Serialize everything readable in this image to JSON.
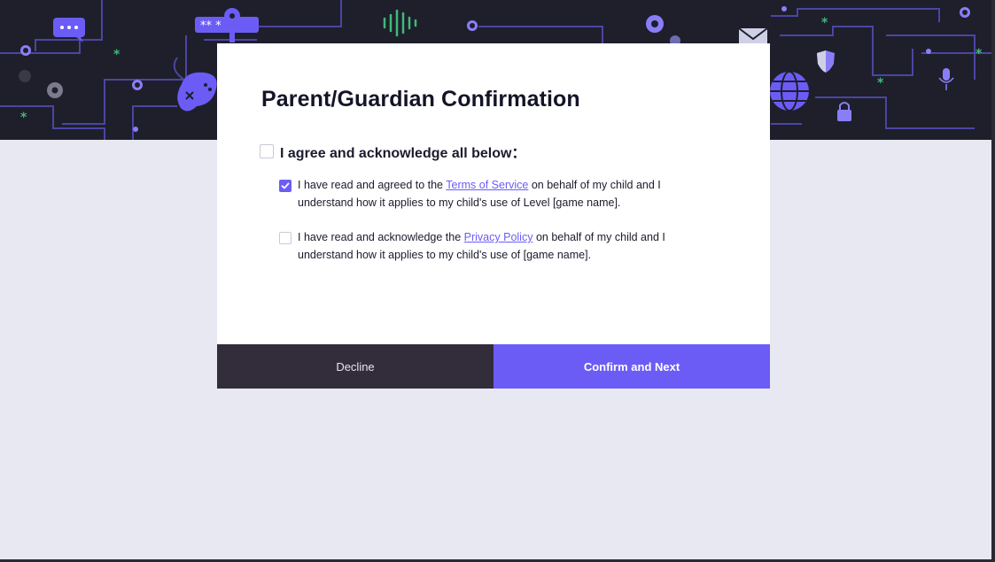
{
  "dialog": {
    "title": "Parent/Guardian Confirmation",
    "master_checkbox": {
      "label": "I agree and acknowledge all below：",
      "checked": false
    },
    "items": [
      {
        "checked": true,
        "text_before": "I have read and agreed to the",
        "link_text": "Terms of Service",
        "text_after": "on behalf of my child and I understand how it applies to my child's use of Level [game name]."
      },
      {
        "checked": false,
        "text_before": "I have read and acknowledge the",
        "link_text": "Privacy Policy",
        "text_after": "on behalf of my child and I understand how it applies to my child's use of  [game name]."
      }
    ],
    "buttons": {
      "decline_label": "Decline",
      "confirm_label": "Confirm and Next"
    }
  },
  "banner": {
    "icons": [
      "chat-icon",
      "password-icon",
      "gear-icon",
      "gamepad-icon",
      "sound-wave-icon",
      "mail-icon",
      "globe-icon",
      "shield-icon",
      "lock-icon",
      "microphone-icon",
      "asterisk-icon"
    ],
    "password_text": "** *"
  },
  "colors": {
    "banner_bg": "#1e1f2b",
    "accent": "#6c5cf6",
    "decline_bg": "#332d3b",
    "page_bg": "#e8e8f2",
    "star_green": "#3fb97a"
  }
}
